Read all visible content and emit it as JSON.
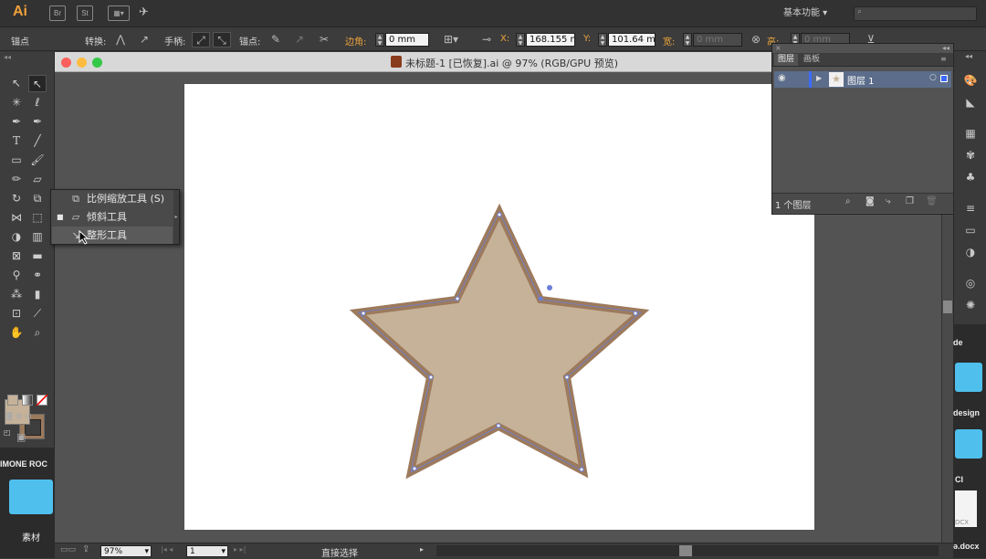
{
  "app": {
    "logo": "Ai",
    "icons": [
      "Br",
      "St"
    ],
    "workspace_label": "基本功能",
    "search_placeholder": ""
  },
  "control": {
    "selection_label": "锚点",
    "convert_label": "转换:",
    "handle_label": "手柄:",
    "anchor_label": "锚点:",
    "corner_label": "边角:",
    "corner_value": "0 mm",
    "x_label": "X:",
    "x_value": "168.155 n",
    "y_label": "Y:",
    "y_value": "101.64 m",
    "w_label": "宽:",
    "w_value": "0 mm",
    "h_label": "高:",
    "h_value": "0 mm"
  },
  "document": {
    "title": "未标题-1 [已恢复].ai @ 97% (RGB/GPU 预览)"
  },
  "flyout": {
    "items": [
      {
        "label": "比例缩放工具",
        "shortcut": "(S)"
      },
      {
        "label": "倾斜工具",
        "shortcut": ""
      },
      {
        "label": "整形工具",
        "shortcut": ""
      }
    ]
  },
  "layers": {
    "tabs": [
      "图层",
      "画板"
    ],
    "layer_name": "图层 1",
    "count_label": "1 个图层"
  },
  "status": {
    "zoom": "97%",
    "page": "1",
    "tool_name": "直接选择"
  },
  "desktop": {
    "left_top_label": "IMONE ROC",
    "left_folder_label": "素材",
    "right_labels": [
      "de",
      "design",
      "CI",
      "DCX",
      "ǝ.docx"
    ]
  },
  "colors": {
    "star_fill": "#c6b298",
    "star_stroke": "#9c7a5c",
    "anchor": "#6b7fd8",
    "accent": "#e9a23b"
  }
}
